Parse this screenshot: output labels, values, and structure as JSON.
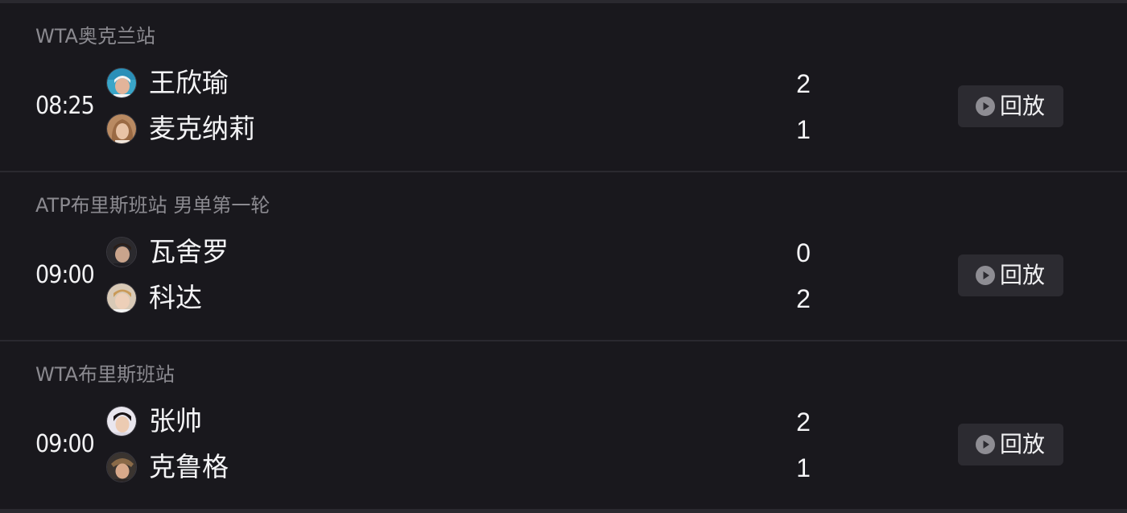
{
  "matches": [
    {
      "tournament": "WTA奥克兰站",
      "time": "08:25",
      "players": [
        {
          "name": "王欣瑜",
          "score": "2",
          "avatar": "player-photo"
        },
        {
          "name": "麦克纳莉",
          "score": "1",
          "avatar": "player-photo"
        }
      ],
      "replay_label": "回放"
    },
    {
      "tournament": "ATP布里斯班站 男单第一轮",
      "time": "09:00",
      "players": [
        {
          "name": "瓦舍罗",
          "score": "0",
          "avatar": "player-photo"
        },
        {
          "name": "科达",
          "score": "2",
          "avatar": "player-photo"
        }
      ],
      "replay_label": "回放"
    },
    {
      "tournament": "WTA布里斯班站",
      "time": "09:00",
      "players": [
        {
          "name": "张帅",
          "score": "2",
          "avatar": "player-photo"
        },
        {
          "name": "克鲁格",
          "score": "1",
          "avatar": "player-photo"
        }
      ],
      "replay_label": "回放"
    }
  ],
  "icons": {
    "replay": "play-circle-icon"
  },
  "colors": {
    "background": "#19181d",
    "divider": "#2a292f",
    "button": "#2c2b31",
    "muted_text": "#8b8a90",
    "text": "#f4f4f6"
  }
}
